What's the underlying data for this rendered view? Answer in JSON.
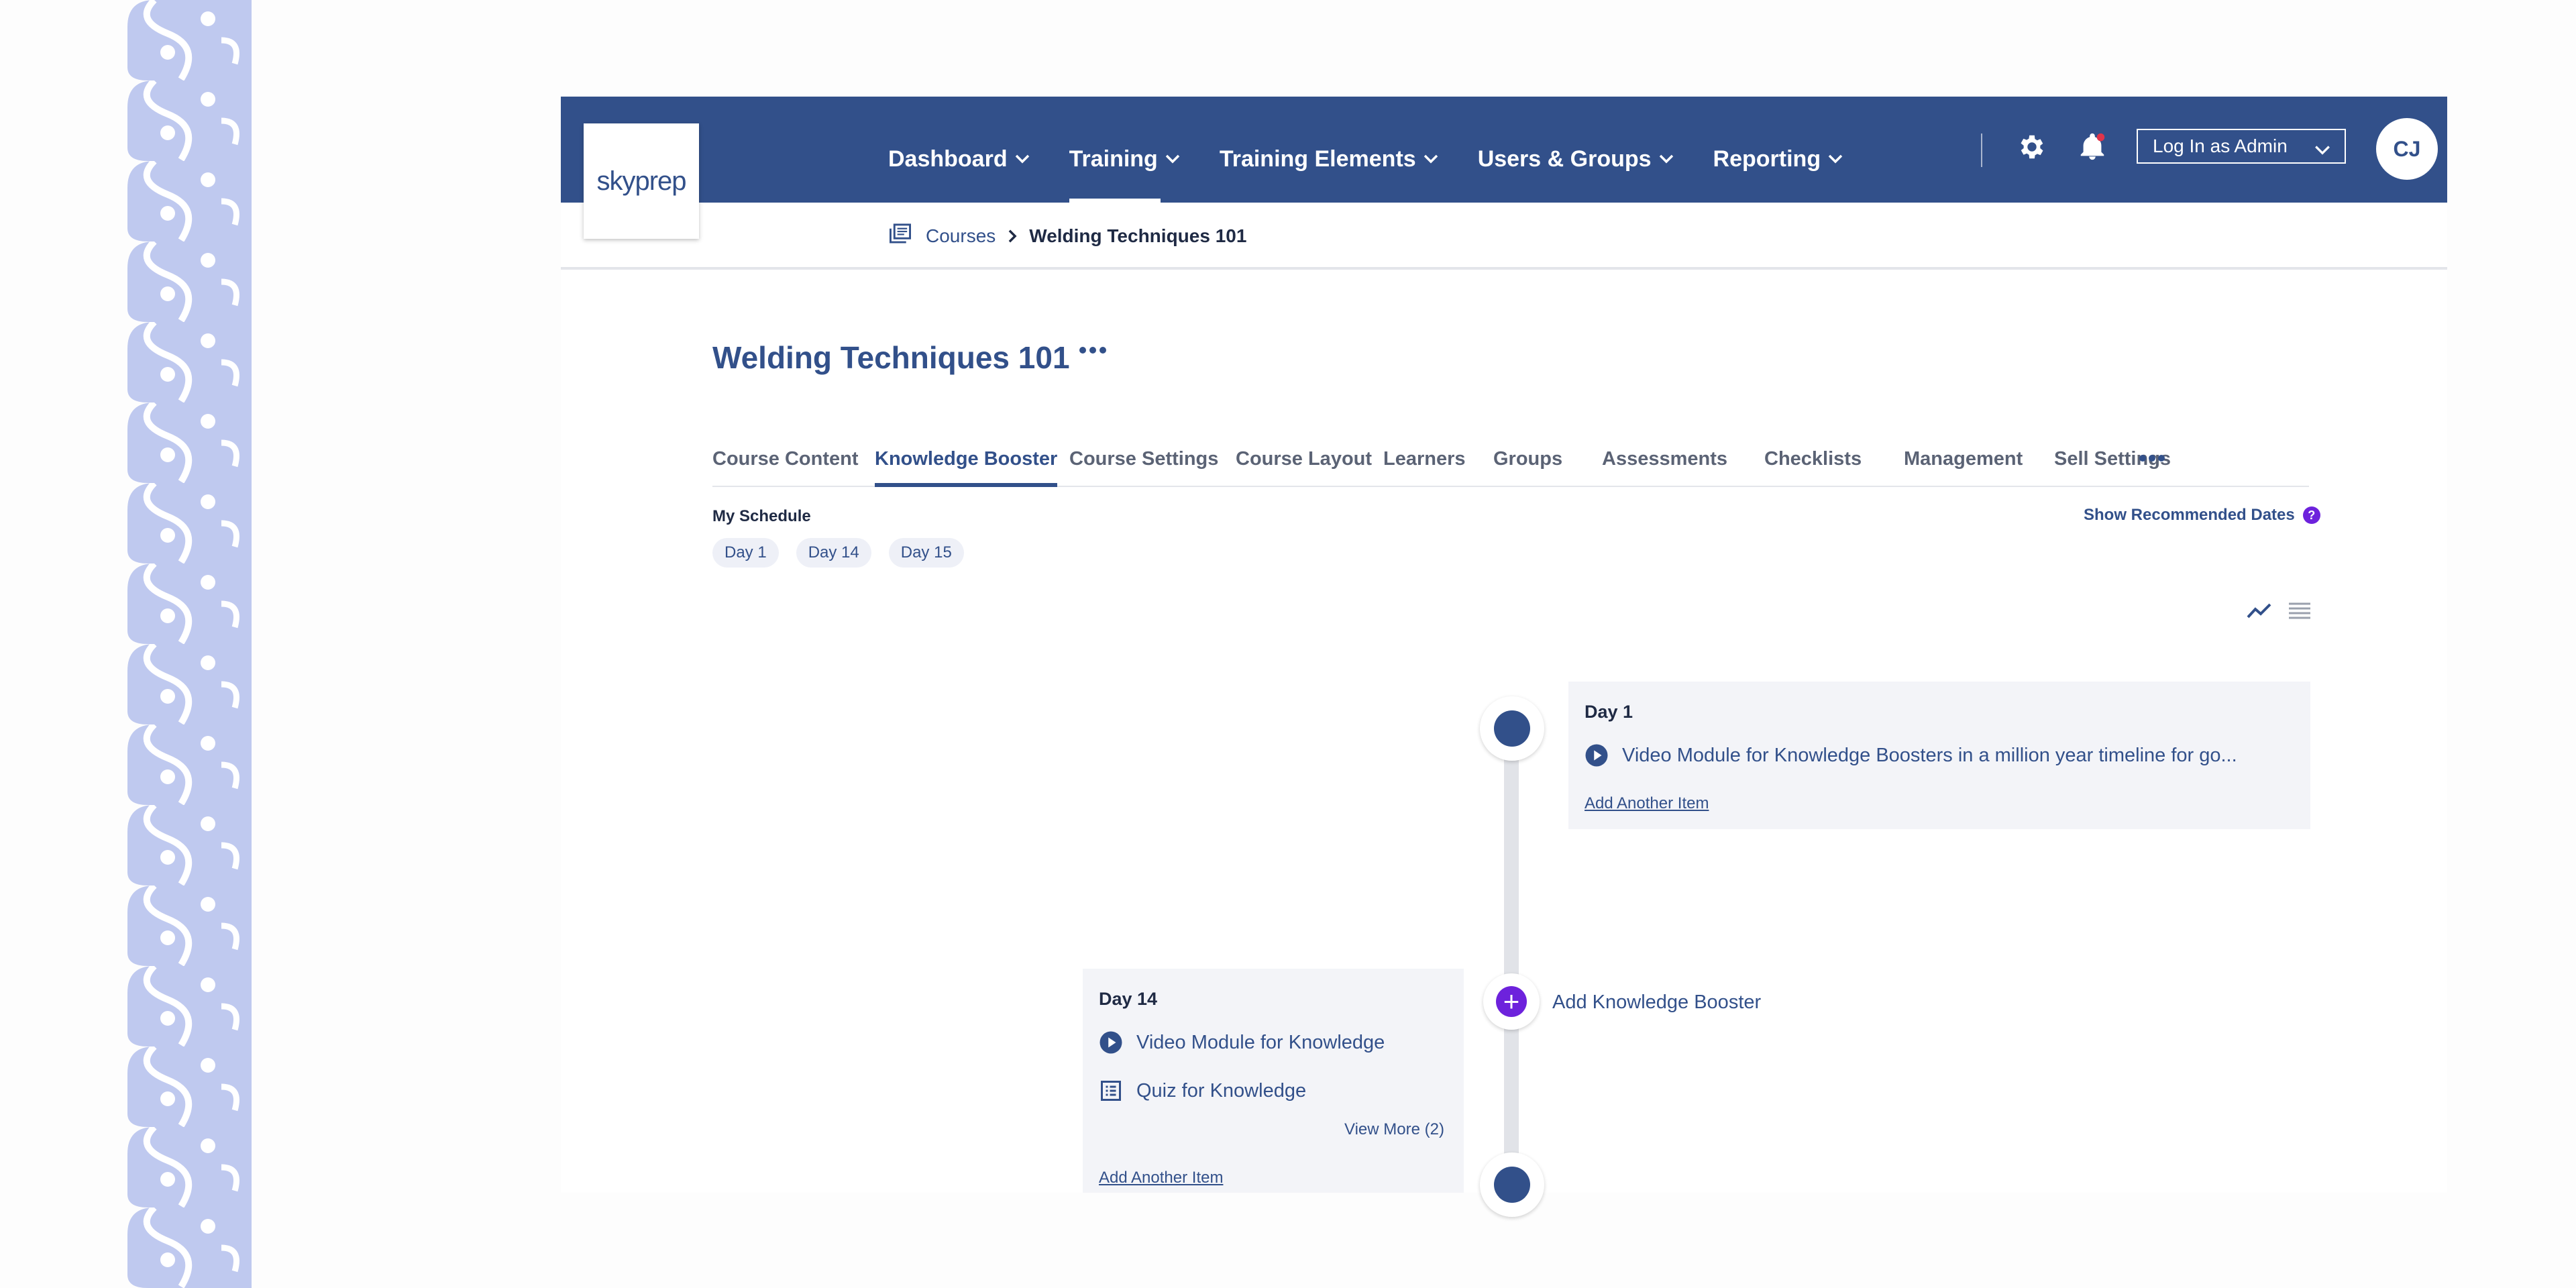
{
  "colors": {
    "brand": "#32508a",
    "accent": "#6d22dc",
    "pattern": "#bfc9ef"
  },
  "header": {
    "logo_text": "skyprep",
    "nav": [
      {
        "label": "Dashboard",
        "active": false
      },
      {
        "label": "Training",
        "active": true
      },
      {
        "label": "Training Elements",
        "active": false
      },
      {
        "label": "Users & Groups",
        "active": false
      },
      {
        "label": "Reporting",
        "active": false
      }
    ],
    "settings_icon": "gear-icon",
    "notifications_icon": "bell-icon",
    "admin_select": "Log In as Admin",
    "avatar_initials": "CJ"
  },
  "breadcrumb": {
    "icon": "courses-icon",
    "link": "Courses",
    "current": "Welding Techniques 101"
  },
  "page": {
    "title": "Welding Techniques 101",
    "tabs": [
      {
        "label": "Course Content",
        "active": false
      },
      {
        "label": "Knowledge Booster",
        "active": true
      },
      {
        "label": "Course Settings",
        "active": false
      },
      {
        "label": "Course Layout",
        "active": false
      },
      {
        "label": "Learners",
        "active": false
      },
      {
        "label": "Groups",
        "active": false
      },
      {
        "label": "Assessments",
        "active": false
      },
      {
        "label": "Checklists",
        "active": false
      },
      {
        "label": "Management",
        "active": false
      },
      {
        "label": "Sell Settings",
        "active": false
      }
    ]
  },
  "schedule": {
    "label": "My Schedule",
    "days": [
      "Day 1",
      "Day 14",
      "Day 15"
    ],
    "show_dates": "Show Recommended Dates",
    "help_badge": "?"
  },
  "timeline": {
    "add_booster": "Add Knowledge Booster",
    "day1": {
      "title": "Day 1",
      "items": [
        {
          "icon": "play-icon",
          "label": "Video Module for Knowledge Boosters in a million year timeline for go..."
        }
      ],
      "add_item": "Add Another Item"
    },
    "day14": {
      "title": "Day 14",
      "items": [
        {
          "icon": "play-icon",
          "label": "Video Module for Knowledge"
        },
        {
          "icon": "quiz-icon",
          "label": "Quiz for Knowledge"
        }
      ],
      "view_more": "View More (2)",
      "add_item": "Add Another Item"
    }
  }
}
